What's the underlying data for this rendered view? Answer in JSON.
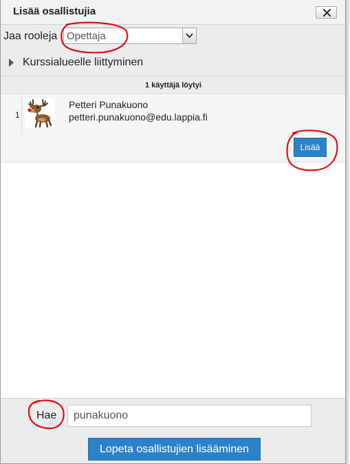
{
  "dialog": {
    "title": "Lisää osallistujia",
    "close_icon": "close-icon"
  },
  "roles": {
    "label": "Jaa rooleja",
    "selected": "Opettaja"
  },
  "enrol_options": {
    "label": "Kurssialueelle liittyminen"
  },
  "results": {
    "count_text": "1 käyttäjä löytyi",
    "rows": [
      {
        "index": "1",
        "name": "Petteri Punakuono",
        "email": "petteri.punakuono@edu.lappia.fi",
        "avatar_icon": "reindeer-avatar-icon",
        "add_label": "Lisää"
      }
    ]
  },
  "search": {
    "label": "Hae",
    "value": "punakuono"
  },
  "footer": {
    "finish_label": "Lopeta osallistujien lisääminen"
  },
  "colors": {
    "button_blue": "#2b82c9",
    "annotation_red": "#e01010",
    "panel_gray": "#ececec"
  }
}
